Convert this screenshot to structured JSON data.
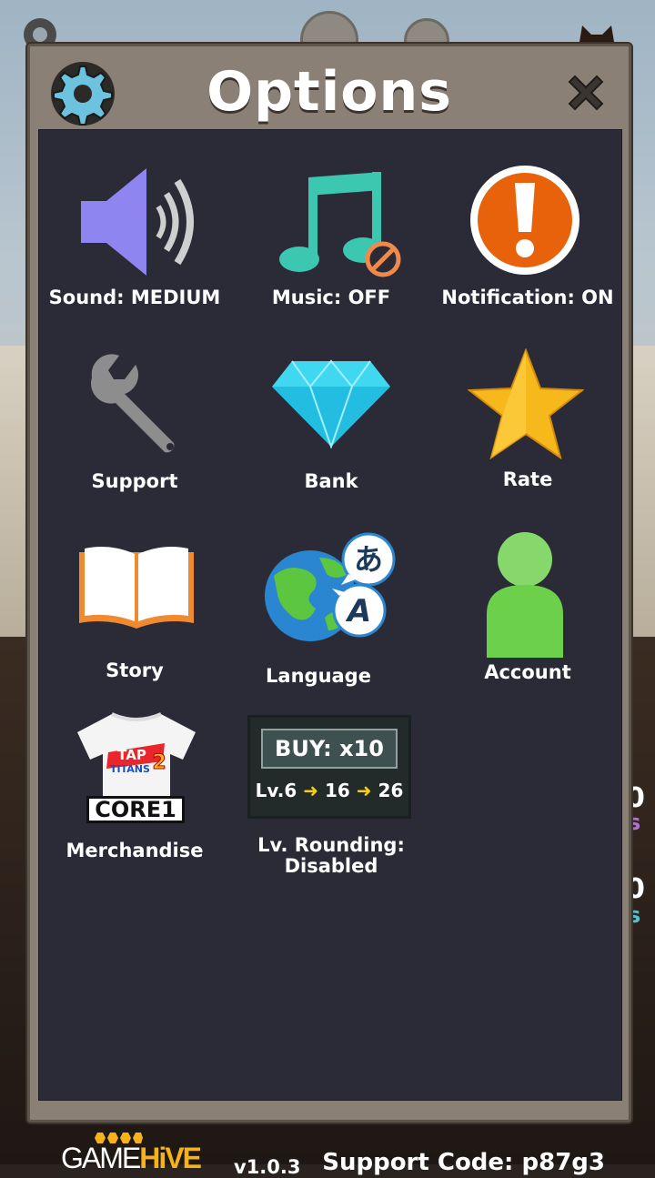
{
  "title": "Options",
  "tiles": {
    "sound": "Sound: MEDIUM",
    "music": "Music: OFF",
    "notification": "Notification: ON",
    "support": "Support",
    "bank": "Bank",
    "rate": "Rate",
    "story": "Story",
    "language": "Language",
    "account": "Account",
    "merchandise": "Merchandise",
    "rounding_line1": "Lv. Rounding:",
    "rounding_line2": "Disabled"
  },
  "buy_widget": {
    "buy_label": "BUY: x10",
    "lv_prefix": "Lv.6",
    "lv_mid": "16",
    "lv_end": "26"
  },
  "merch_shirt": {
    "logo_top": "TAP",
    "logo_bottom": "TITANS",
    "logo_number": "2",
    "core_text": "CORE1"
  },
  "language_icon": {
    "glyph1": "あ",
    "glyph2": "A"
  },
  "footer": {
    "logo_game": "GAME",
    "logo_hive": "HiVE",
    "version": "v1.0.3",
    "support_code": "Support Code: p87g3"
  },
  "side_text": {
    "a": "0",
    "b": "s",
    "c": "0",
    "d": "s"
  },
  "colors": {
    "panel_bg": "#2b2b38",
    "frame": "#8a8076",
    "accent_orange": "#e8620c",
    "gem": "#40d8f0",
    "star": "#f6b81a",
    "account_green": "#6dd04a",
    "speaker_purple": "#8e85f0",
    "music_teal": "#3cc7b0"
  }
}
